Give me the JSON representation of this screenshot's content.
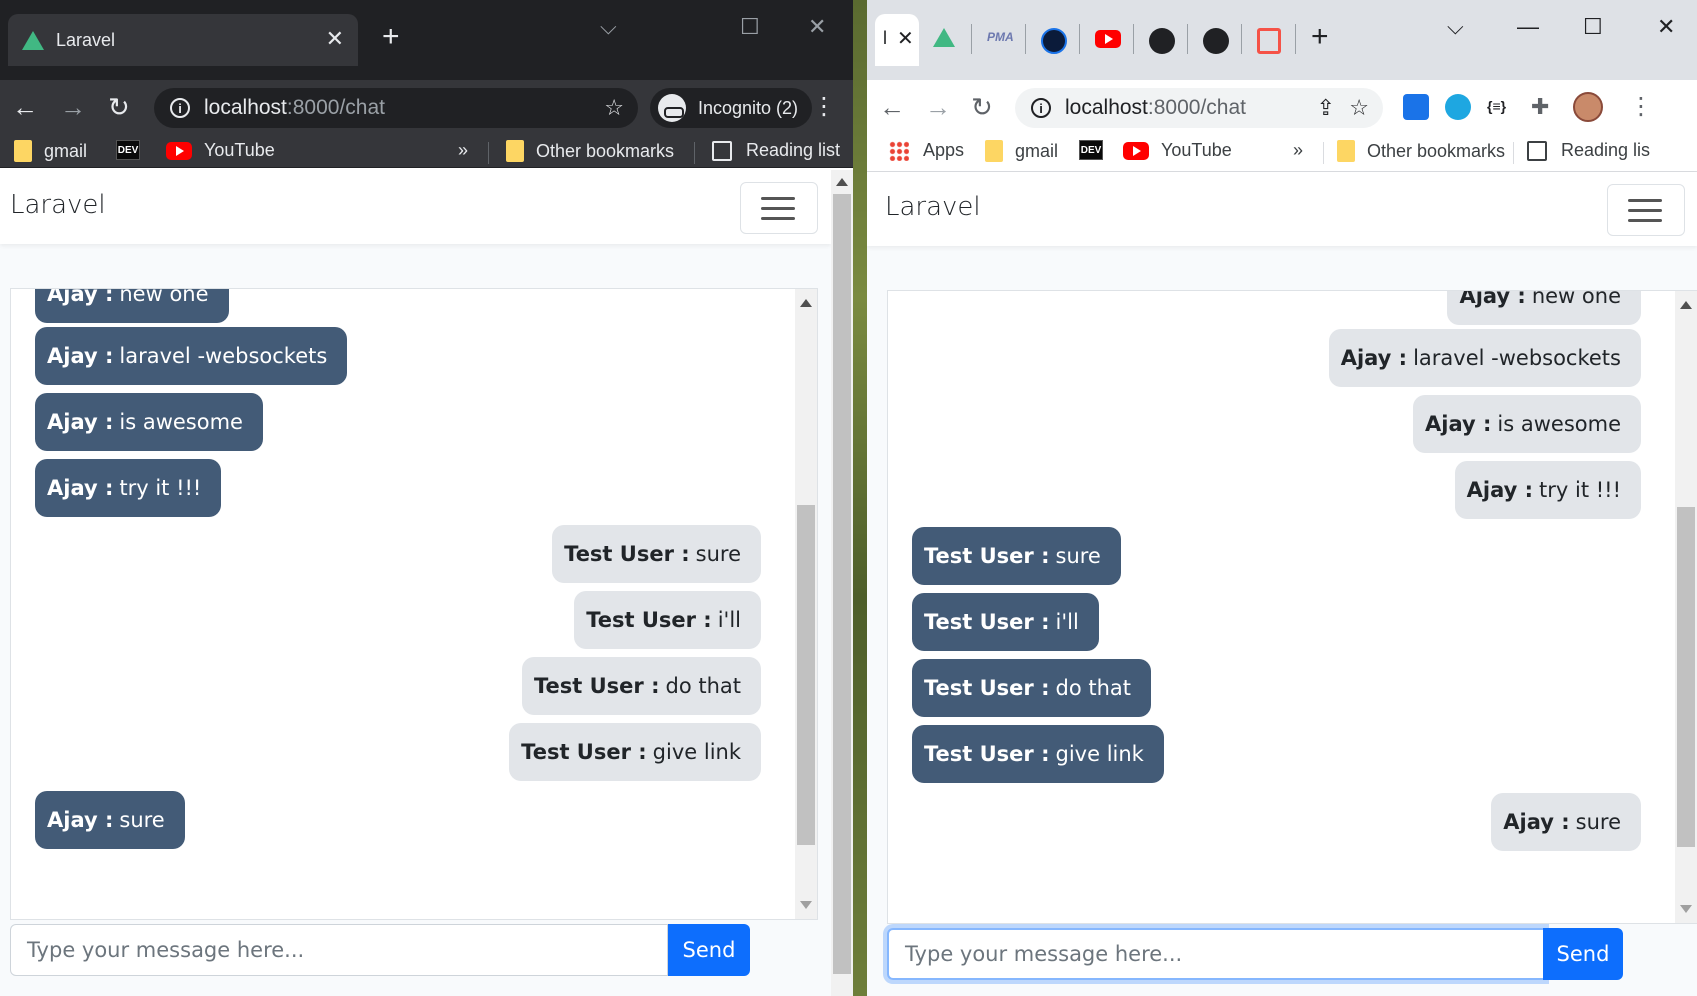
{
  "left_window": {
    "tab_title": "Laravel",
    "tab_close": "✕",
    "new_tab": "+",
    "url_host": "localhost",
    "url_path": ":8000/chat",
    "incognito_label": "Incognito (2)",
    "bookmarks": {
      "gmail": "gmail",
      "dev": "DEV",
      "youtube": "YouTube",
      "more": "»",
      "other": "Other bookmarks",
      "reading": "Reading list"
    },
    "brand": "Laravel",
    "messages": [
      {
        "user": "Ajay :",
        "text": "new one"
      },
      {
        "user": "Ajay :",
        "text": "laravel -websockets"
      },
      {
        "user": "Ajay :",
        "text": "is awesome"
      },
      {
        "user": "Ajay :",
        "text": "try it !!!"
      },
      {
        "user": "Test User :",
        "text": "sure"
      },
      {
        "user": "Test User :",
        "text": "i'll"
      },
      {
        "user": "Test User :",
        "text": "do that"
      },
      {
        "user": "Test User :",
        "text": "give link"
      },
      {
        "user": "Ajay :",
        "text": "sure"
      }
    ],
    "input_placeholder": "Type your message here...",
    "send_label": "Send"
  },
  "right_window": {
    "tab_title": "l",
    "tab_close": "✕",
    "new_tab": "+",
    "url_host": "localhost",
    "url_path": ":8000/chat",
    "bookmarks": {
      "apps": "Apps",
      "gmail": "gmail",
      "dev": "DEV",
      "youtube": "YouTube",
      "more": "»",
      "other": "Other bookmarks",
      "reading": "Reading lis"
    },
    "brand": "Laravel",
    "messages": [
      {
        "user": "Ajay :",
        "text": "new one"
      },
      {
        "user": "Ajay :",
        "text": "laravel -websockets"
      },
      {
        "user": "Ajay :",
        "text": "is awesome"
      },
      {
        "user": "Ajay :",
        "text": "try it !!!"
      },
      {
        "user": "Test User :",
        "text": "sure"
      },
      {
        "user": "Test User :",
        "text": "i'll"
      },
      {
        "user": "Test User :",
        "text": "do that"
      },
      {
        "user": "Test User :",
        "text": "give link"
      },
      {
        "user": "Ajay :",
        "text": "sure"
      }
    ],
    "input_placeholder": "Type your message here...",
    "send_label": "Send"
  },
  "colors": {
    "bubble_dark": "#435b77",
    "bubble_light": "#e2e5e9",
    "send_button": "#0d6efd"
  }
}
